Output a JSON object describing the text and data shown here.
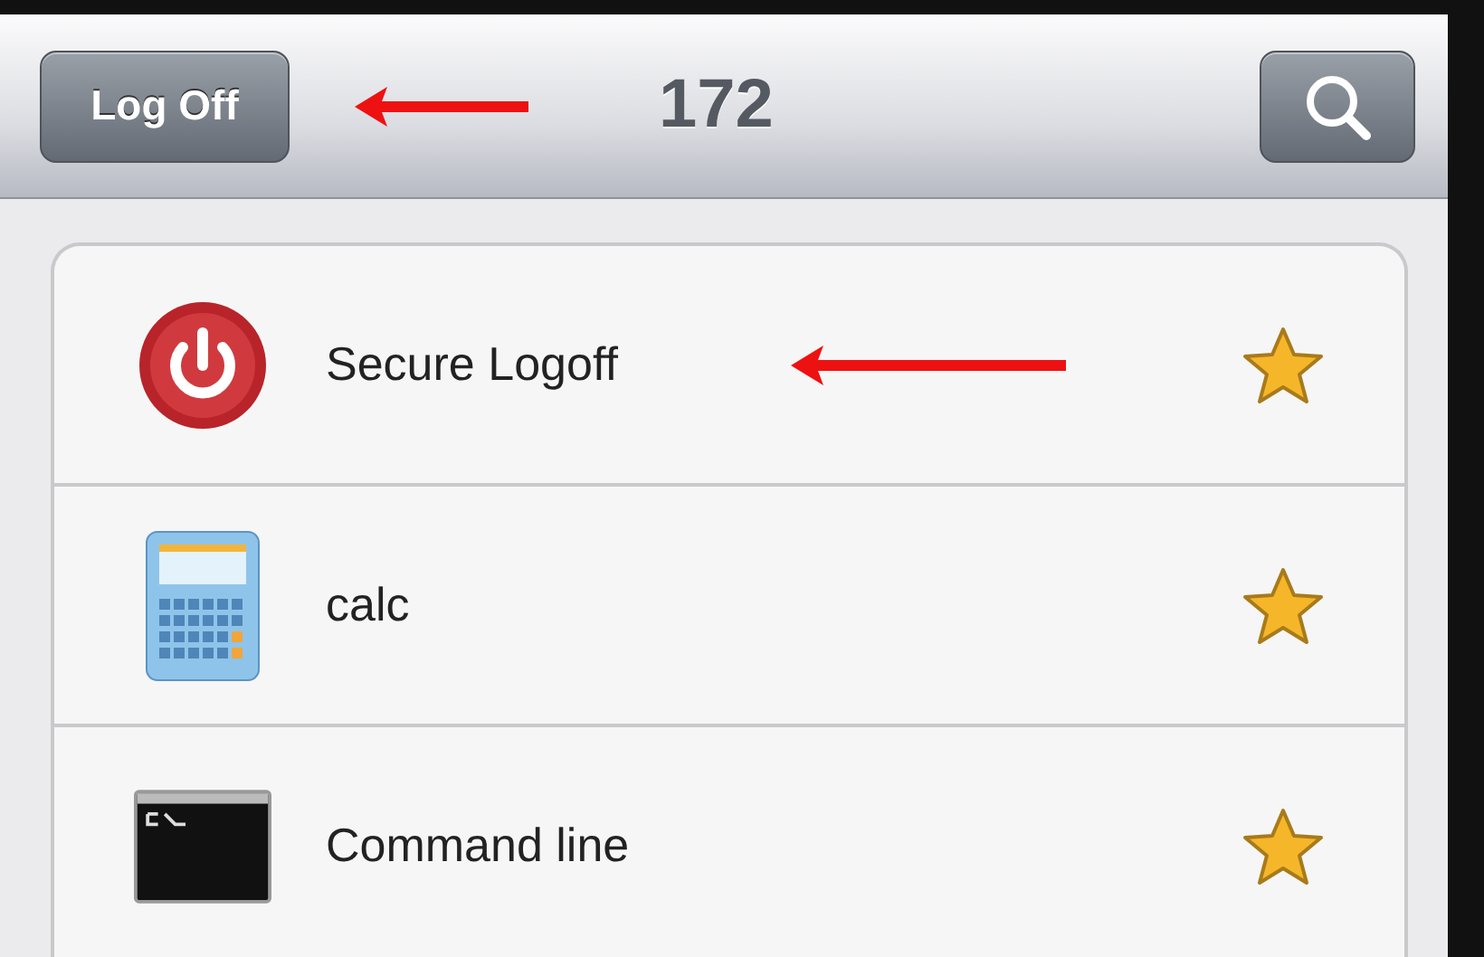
{
  "nav_bar": {
    "button": "Log Off",
    "title": "172"
  },
  "items": [
    {
      "kind": "power",
      "label": "Secure Logoff",
      "favorite": true,
      "annotated": true
    },
    {
      "kind": "calculator",
      "label": "calc",
      "favorite": true,
      "annotated": false
    },
    {
      "kind": "terminal",
      "label": "Command line",
      "favorite": true,
      "annotated": false
    }
  ]
}
